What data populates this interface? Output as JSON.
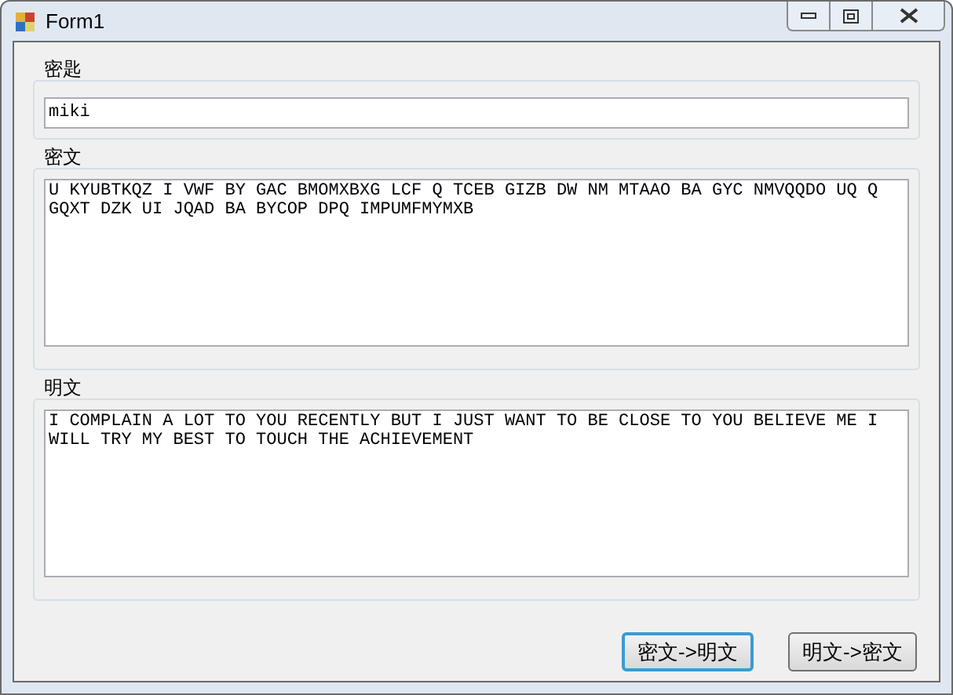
{
  "window": {
    "title": "Form1"
  },
  "groups": [
    {
      "label": "密匙",
      "kind": "single",
      "value": "miki"
    },
    {
      "label": "密文",
      "kind": "multi",
      "value": "U KYUBTKQZ I VWF BY GAC BMOMXBXG LCF Q TCEB GIZB DW NM MTAAO BA GYC NMVQQDO UQ Q GQXT DZK UI JQAD BA BYCOP DPQ IMPUMFMYMXB"
    },
    {
      "label": "明文",
      "kind": "multi",
      "value": "I COMPLAIN A LOT TO YOU RECENTLY BUT I JUST WANT TO BE CLOSE TO YOU BELIEVE ME I WILL TRY MY BEST TO TOUCH THE ACHIEVEMENT"
    }
  ],
  "buttons": [
    {
      "label": "密文->明文",
      "focused": true
    },
    {
      "label": "明文->密文",
      "focused": false
    }
  ]
}
